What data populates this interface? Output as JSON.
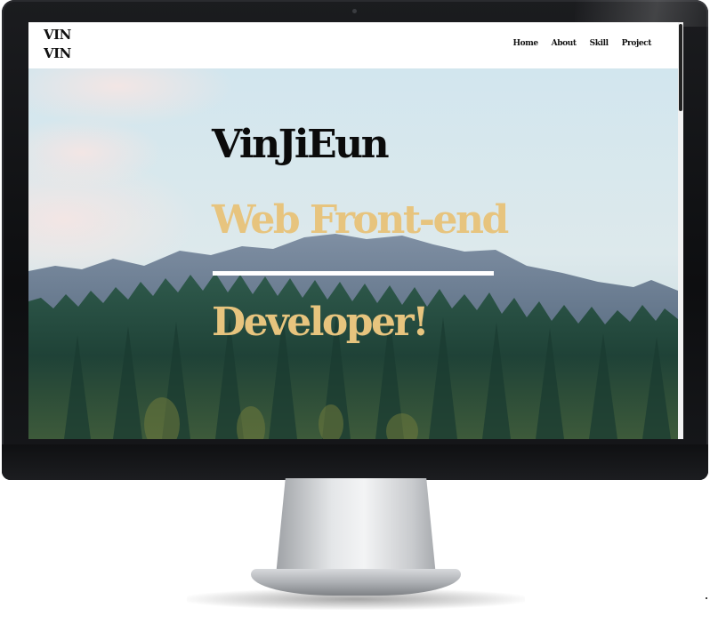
{
  "site": {
    "logo_line_1": "VIN",
    "logo_line_2": "VIN"
  },
  "nav": {
    "items": [
      {
        "label": "Home"
      },
      {
        "label": "About"
      },
      {
        "label": "Skill"
      },
      {
        "label": "Project"
      }
    ]
  },
  "hero": {
    "name": "VinJiEun",
    "role_line_1": "Web Front-end",
    "role_line_2": "Developer!",
    "background": "mountain-forest-landscape"
  },
  "colors": {
    "accent": "#e7c47e",
    "heading": "#0b0b0b",
    "divider": "#ffffff",
    "navbar_bg": "#ffffff"
  }
}
